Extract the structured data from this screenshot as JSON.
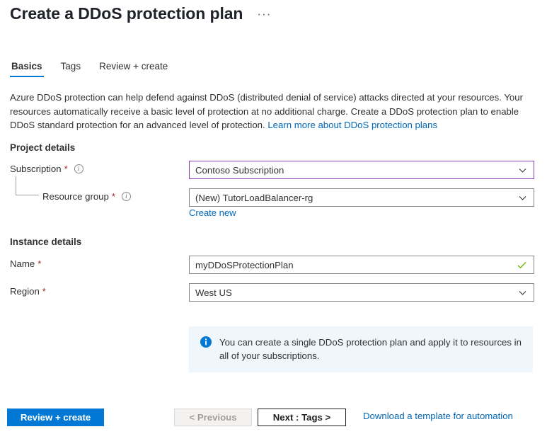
{
  "header": {
    "title": "Create a DDoS protection plan",
    "more_menu": "···"
  },
  "tabs": [
    {
      "label": "Basics",
      "active": true
    },
    {
      "label": "Tags",
      "active": false
    },
    {
      "label": "Review + create",
      "active": false
    }
  ],
  "description": {
    "text": "Azure DDoS protection can help defend against DDoS (distributed denial of service) attacks directed at your resources. Your resources automatically receive a basic level of protection at no additional charge. Create a DDoS protection plan to enable DDoS standard protection for an advanced level of protection. ",
    "link_label": "Learn more about DDoS protection plans"
  },
  "sections": {
    "project_details": {
      "title": "Project details",
      "subscription": {
        "label": "Subscription",
        "required_marker": "*",
        "value": "Contoso Subscription",
        "focused": true
      },
      "resource_group": {
        "label": "Resource group",
        "required_marker": "*",
        "value": "(New) TutorLoadBalancer-rg",
        "create_new_label": "Create new"
      }
    },
    "instance_details": {
      "title": "Instance details",
      "name": {
        "label": "Name",
        "required_marker": "*",
        "value": "myDDoSProtectionPlan",
        "valid": true
      },
      "region": {
        "label": "Region",
        "required_marker": "*",
        "value": "West US"
      }
    }
  },
  "info_banner": {
    "text": "You can create a single DDoS protection plan and apply it to resources in all of your subscriptions."
  },
  "footer": {
    "review_create_label": "Review + create",
    "previous_label": "< Previous",
    "next_label": "Next : Tags >",
    "download_template_label": "Download a template for automation"
  },
  "colors": {
    "accent_blue": "#0078d4",
    "link_blue": "#0067b8",
    "focus_purple": "#8a3faf",
    "required_red": "#a4262c",
    "valid_green": "#6bb700",
    "banner_bg": "#eff6fc"
  }
}
